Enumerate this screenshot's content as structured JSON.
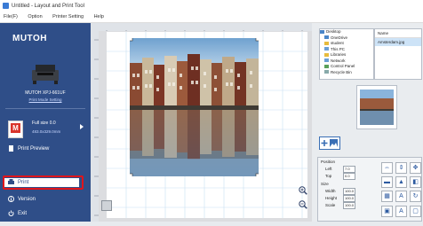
{
  "window": {
    "title": "Untitled - Layout and Print Tool"
  },
  "menu": [
    "File(F)",
    "Option",
    "Printer Setting",
    "Help"
  ],
  "sidebar": {
    "brand": "MUTOH",
    "printer_name": "MUTOH XPJ-661UF",
    "printer_link": "Print Mode Setting",
    "media_name": "Full size 0.0",
    "media_size": "483.0x329.0mm",
    "nav": [
      {
        "label": "Print Preview",
        "icon": "preview-icon"
      },
      {
        "label": "Print",
        "icon": "print-icon"
      },
      {
        "label": "Version",
        "icon": "info-icon"
      },
      {
        "label": "Exit",
        "icon": "power-icon"
      }
    ],
    "highlight_color": "#e0151b"
  },
  "tree": [
    "Desktop",
    "OneDrive",
    "student",
    "This PC",
    "Libraries",
    "Network",
    "Control Panel",
    "Recycle Bin"
  ],
  "filelist": {
    "header": "Name",
    "item": "Amsterdam.jpg"
  },
  "properties": {
    "position_label": "Position",
    "left_label": "Left",
    "left_value": "7.0",
    "top_label": "Top",
    "top_value": "0.0",
    "size_label": "Size",
    "width_label": "Width",
    "width_value": "100.0",
    "height_label": "Height",
    "height_value": "100.0",
    "scale_label": "Scale",
    "scale_value": "100.0"
  },
  "colors": {
    "sidebar": "#2f4e88",
    "accent": "#3a6fb5"
  }
}
